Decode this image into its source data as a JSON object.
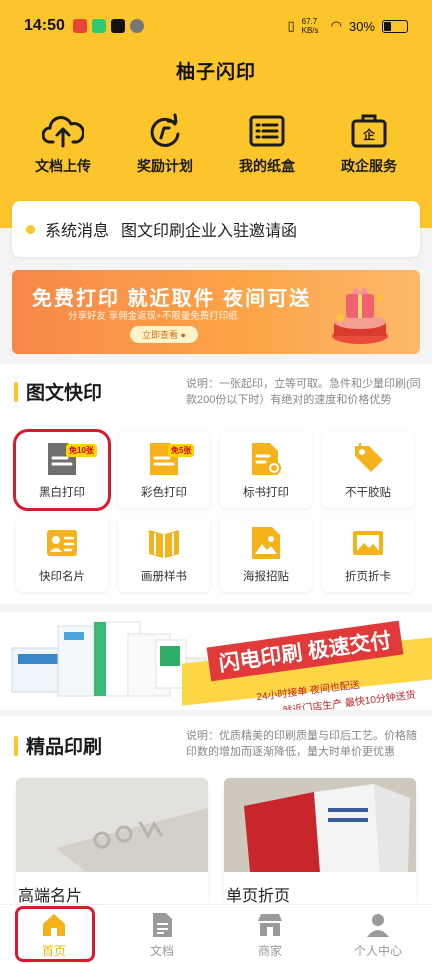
{
  "status_bar": {
    "time": "14:50",
    "network_speed": "67.7 KB/s",
    "battery": "30%",
    "battery_level": 0.3
  },
  "header": {
    "title": "柚子闪印"
  },
  "quick_actions": [
    {
      "label": "文档上传",
      "icon": "cloud-upload-icon"
    },
    {
      "label": "奖励计划",
      "icon": "refresh-icon"
    },
    {
      "label": "我的纸盒",
      "icon": "list-icon"
    },
    {
      "label": "政企服务",
      "icon": "briefcase-icon"
    }
  ],
  "notice": {
    "label": "系统消息",
    "text": "图文印刷企业入驻邀请函"
  },
  "banner_promo": {
    "headline": "免费打印  就近取件  夜间可送",
    "subline": "分享好友 享佣金返现+不限量免费打印纸",
    "button": "立即查看 ●"
  },
  "quick_print": {
    "title": "图文快印",
    "description": "说明：一张起印，立等可取。急件和少量印刷(同款200份以下时）有绝对的速度和价格优势",
    "items": [
      {
        "label": "黑白打印",
        "badge": "免10张",
        "icon": "bw-document-icon"
      },
      {
        "label": "彩色打印",
        "badge": "免5张",
        "icon": "color-document-icon"
      },
      {
        "label": "标书打印",
        "badge": "",
        "icon": "certificate-document-icon"
      },
      {
        "label": "不干胶贴",
        "badge": "",
        "icon": "tag-icon"
      },
      {
        "label": "快印名片",
        "badge": "",
        "icon": "business-card-icon"
      },
      {
        "label": "画册样书",
        "badge": "",
        "icon": "book-icon"
      },
      {
        "label": "海报招贴",
        "badge": "",
        "icon": "poster-icon"
      },
      {
        "label": "折页折卡",
        "badge": "",
        "icon": "folded-card-icon"
      }
    ]
  },
  "banner_flash": {
    "headline": "闪电印刷 极速交付",
    "line1": "24小时接单  夜间也配送",
    "line2": "就近门店生产  最快10分钟送货"
  },
  "premium_print": {
    "title": "精品印刷",
    "description": "说明：优质精美的印刷质量与印后工艺。价格随印数的增加而逐渐降低，量大时单价更优惠",
    "products": [
      {
        "label": "高端名片"
      },
      {
        "label": "单页折页"
      }
    ]
  },
  "tabbar": [
    {
      "label": "首页",
      "icon": "home-icon",
      "active": true
    },
    {
      "label": "文档",
      "icon": "document-icon",
      "active": false
    },
    {
      "label": "商家",
      "icon": "store-icon",
      "active": false
    },
    {
      "label": "个人中心",
      "icon": "user-icon",
      "active": false
    }
  ],
  "colors": {
    "brand_yellow": "#fdc52c",
    "accent_red": "#d81b2c",
    "tab_active": "#f6b21a"
  }
}
